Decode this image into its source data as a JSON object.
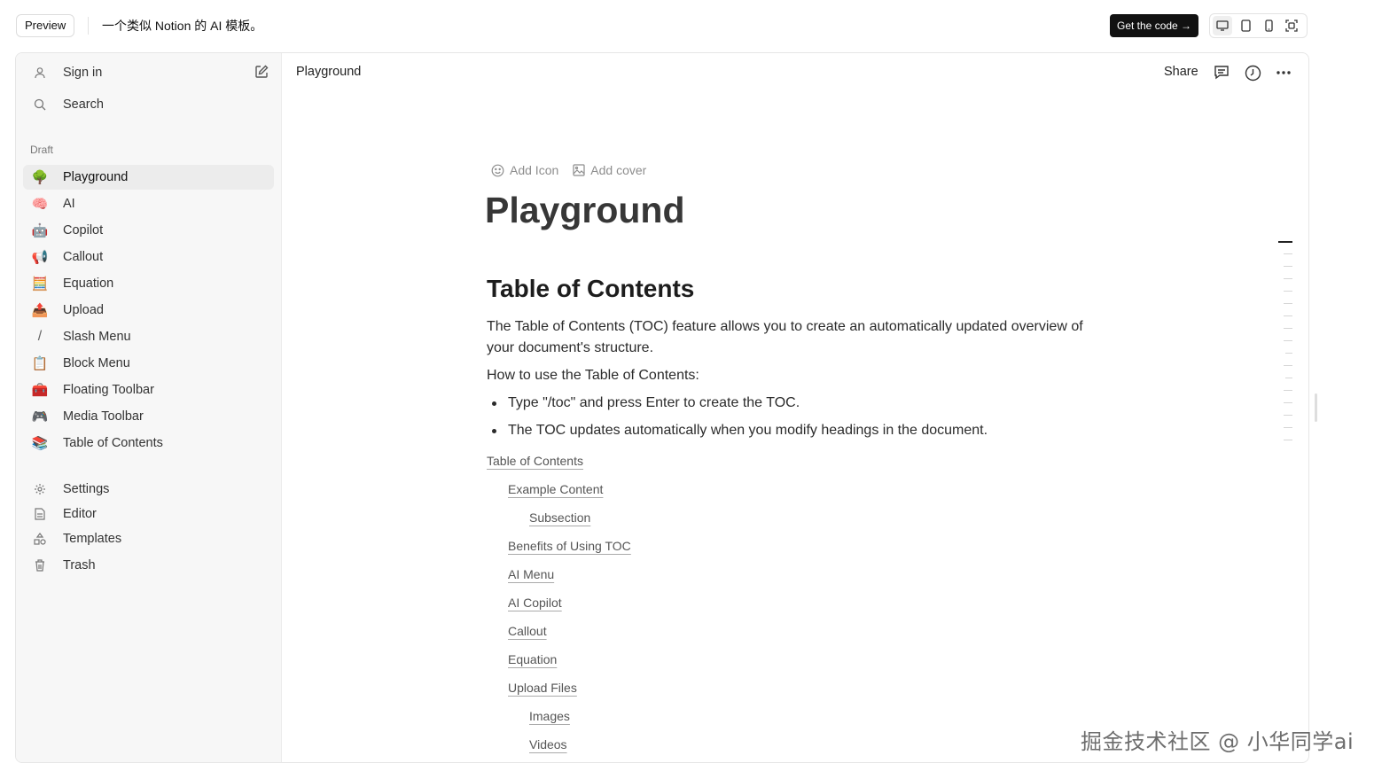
{
  "topbar": {
    "preview_label": "Preview",
    "title": "一个类似 Notion 的 AI 模板。",
    "get_code_label": "Get the code →",
    "devices": [
      "desktop-icon",
      "tablet-icon",
      "phone-icon",
      "fullscreen-icon"
    ]
  },
  "sidebar": {
    "sign_in": "Sign in",
    "search": "Search",
    "section_label": "Draft",
    "pages": [
      {
        "emoji": "🌳",
        "label": "Playground"
      },
      {
        "emoji": "🧠",
        "label": "AI"
      },
      {
        "emoji": "🤖",
        "label": "Copilot"
      },
      {
        "emoji": "📢",
        "label": "Callout"
      },
      {
        "emoji": "🧮",
        "label": "Equation"
      },
      {
        "emoji": "📤",
        "label": "Upload"
      },
      {
        "emoji": "/",
        "label": "Slash Menu"
      },
      {
        "emoji": "📋",
        "label": "Block Menu"
      },
      {
        "emoji": "🧰",
        "label": "Floating Toolbar"
      },
      {
        "emoji": "🎮",
        "label": "Media Toolbar"
      },
      {
        "emoji": "📚",
        "label": "Table of Contents"
      }
    ],
    "bottom": [
      {
        "icon": "gear-icon",
        "label": "Settings"
      },
      {
        "icon": "document-icon",
        "label": "Editor"
      },
      {
        "icon": "shapes-icon",
        "label": "Templates"
      },
      {
        "icon": "trash-icon",
        "label": "Trash"
      }
    ]
  },
  "header": {
    "breadcrumb": "Playground",
    "share_label": "Share"
  },
  "editor": {
    "add_icon_label": "Add Icon",
    "add_cover_label": "Add cover",
    "page_title": "Playground",
    "heading": "Table of Contents",
    "paragraph1": "The Table of Contents (TOC) feature allows you to create an automatically updated overview of your document's structure.",
    "paragraph2": "How to use the Table of Contents:",
    "bullets": [
      "Type \"/toc\" and press Enter to create the TOC.",
      "The TOC updates automatically when you modify headings in the document."
    ],
    "toc": [
      {
        "label": "Table of Contents",
        "level": 0
      },
      {
        "label": "Example Content",
        "level": 1
      },
      {
        "label": "Subsection",
        "level": 2
      },
      {
        "label": "Benefits of Using TOC",
        "level": 1
      },
      {
        "label": "AI Menu",
        "level": 1
      },
      {
        "label": "AI Copilot",
        "level": 1
      },
      {
        "label": "Callout",
        "level": 1
      },
      {
        "label": "Equation",
        "level": 1
      },
      {
        "label": "Upload Files",
        "level": 1
      },
      {
        "label": "Images",
        "level": 2
      },
      {
        "label": "Videos",
        "level": 2
      }
    ]
  },
  "watermark": "掘金技术社区 @ 小华同学ai"
}
